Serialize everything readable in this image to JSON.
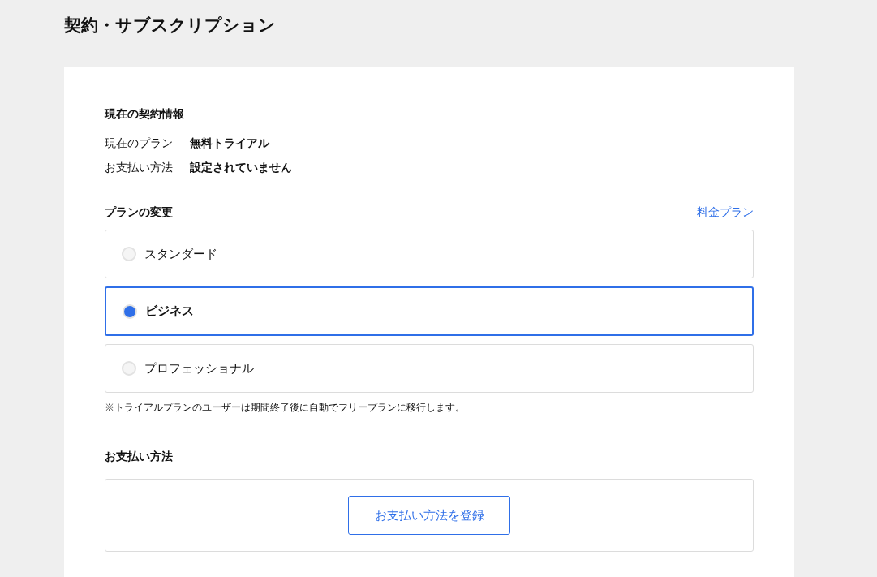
{
  "page": {
    "title": "契約・サブスクリプション"
  },
  "current_contract": {
    "heading": "現在の契約情報",
    "rows": [
      {
        "label": "現在のプラン",
        "value": "無料トライアル"
      },
      {
        "label": "お支払い方法",
        "value": "設定されていません"
      }
    ]
  },
  "plan_change": {
    "heading": "プランの変更",
    "link": "料金プラン",
    "options": [
      {
        "label": "スタンダード",
        "selected": false
      },
      {
        "label": "ビジネス",
        "selected": true
      },
      {
        "label": "プロフェッショナル",
        "selected": false
      }
    ],
    "note": "※トライアルプランのユーザーは期間終了後に自動でフリープランに移行します。"
  },
  "payment": {
    "heading": "お支払い方法",
    "button": "お支払い方法を登録"
  }
}
